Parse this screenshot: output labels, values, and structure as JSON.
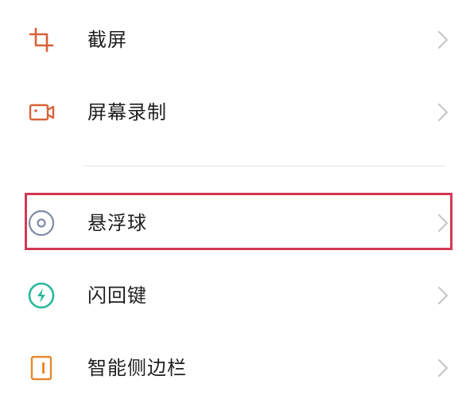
{
  "menu": {
    "items": [
      {
        "label": "截屏",
        "icon": "crop-icon",
        "icon_color": "#d9623a"
      },
      {
        "label": "屏幕录制",
        "icon": "screen-record-icon",
        "icon_color": "#d9623a"
      },
      {
        "label": "悬浮球",
        "icon": "floating-ball-icon",
        "icon_color": "#7f8aa5",
        "highlighted": true
      },
      {
        "label": "闪回键",
        "icon": "flashback-key-icon",
        "icon_color": "#28b89a"
      },
      {
        "label": "智能侧边栏",
        "icon": "smart-sidebar-icon",
        "icon_color": "#e58a2e"
      }
    ]
  },
  "colors": {
    "highlight": "#d23a55",
    "chevron": "#c4c4c4",
    "divider": "#e6e6e6"
  }
}
